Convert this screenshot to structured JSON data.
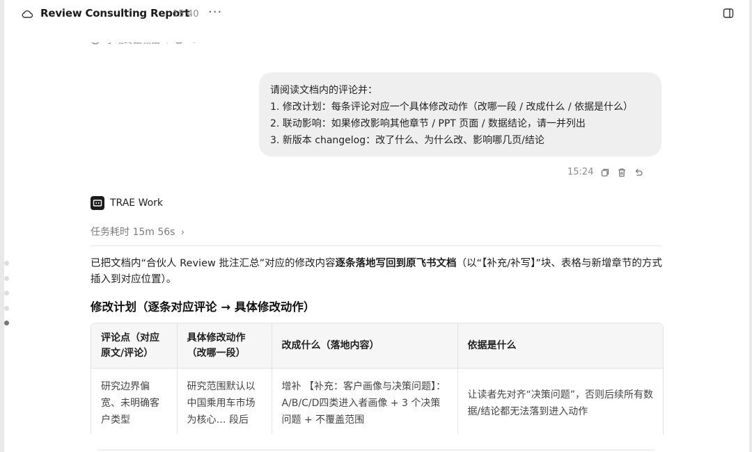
{
  "header": {
    "title": "Review Consulting Report",
    "time": "15:40",
    "more_label": "···"
  },
  "cut_toolbar": {
    "stop_label": "手动终止输出"
  },
  "user_message": {
    "lines": [
      "请阅读文档内的评论并：",
      "1. 修改计划：每条评论对应一个具体修改动作（改哪一段 / 改成什么 / 依据是什么）",
      "2. 联动影响：如果修改影响其他章节 / PPT 页面 / 数据结论，请一并列出",
      "3. 新版本 changelog：改了什么、为什么改、影响哪几页/结论"
    ],
    "time": "15:24"
  },
  "assistant": {
    "name": "TRAE Work",
    "duration": "任务耗时 15m 56s",
    "summary_part1": "已把文档内“合伙人 Review 批注汇总”对应的修改内容",
    "summary_bold": "逐条落地写回到原飞书文档",
    "summary_part2": "（以“【补充/补写】”块、表格与新增章节的方式插入到对应位置）。",
    "section_title": "修改计划（逐条对应评论 → 具体修改动作）"
  },
  "table": {
    "headers": [
      "评论点（对应原文/评论）",
      "具体修改动作（改哪一段）",
      "改成什么（落地内容）",
      "依据是什么"
    ],
    "rows": [
      [
        "研究边界偏宽、未明确客户类型",
        "研究范围默认以中国乘用车市场为核心… 段后",
        "增补 【补充：客户画像与决策问题】：A/B/C/D四类进入者画像 + 3 个决策问题 + 不覆盖范围",
        "让读者先对齐“决策问题”，否则后续所有数据/结论都无法落到进入动作"
      ]
    ]
  },
  "side_nav": {
    "active_index": 4,
    "count": 5
  }
}
